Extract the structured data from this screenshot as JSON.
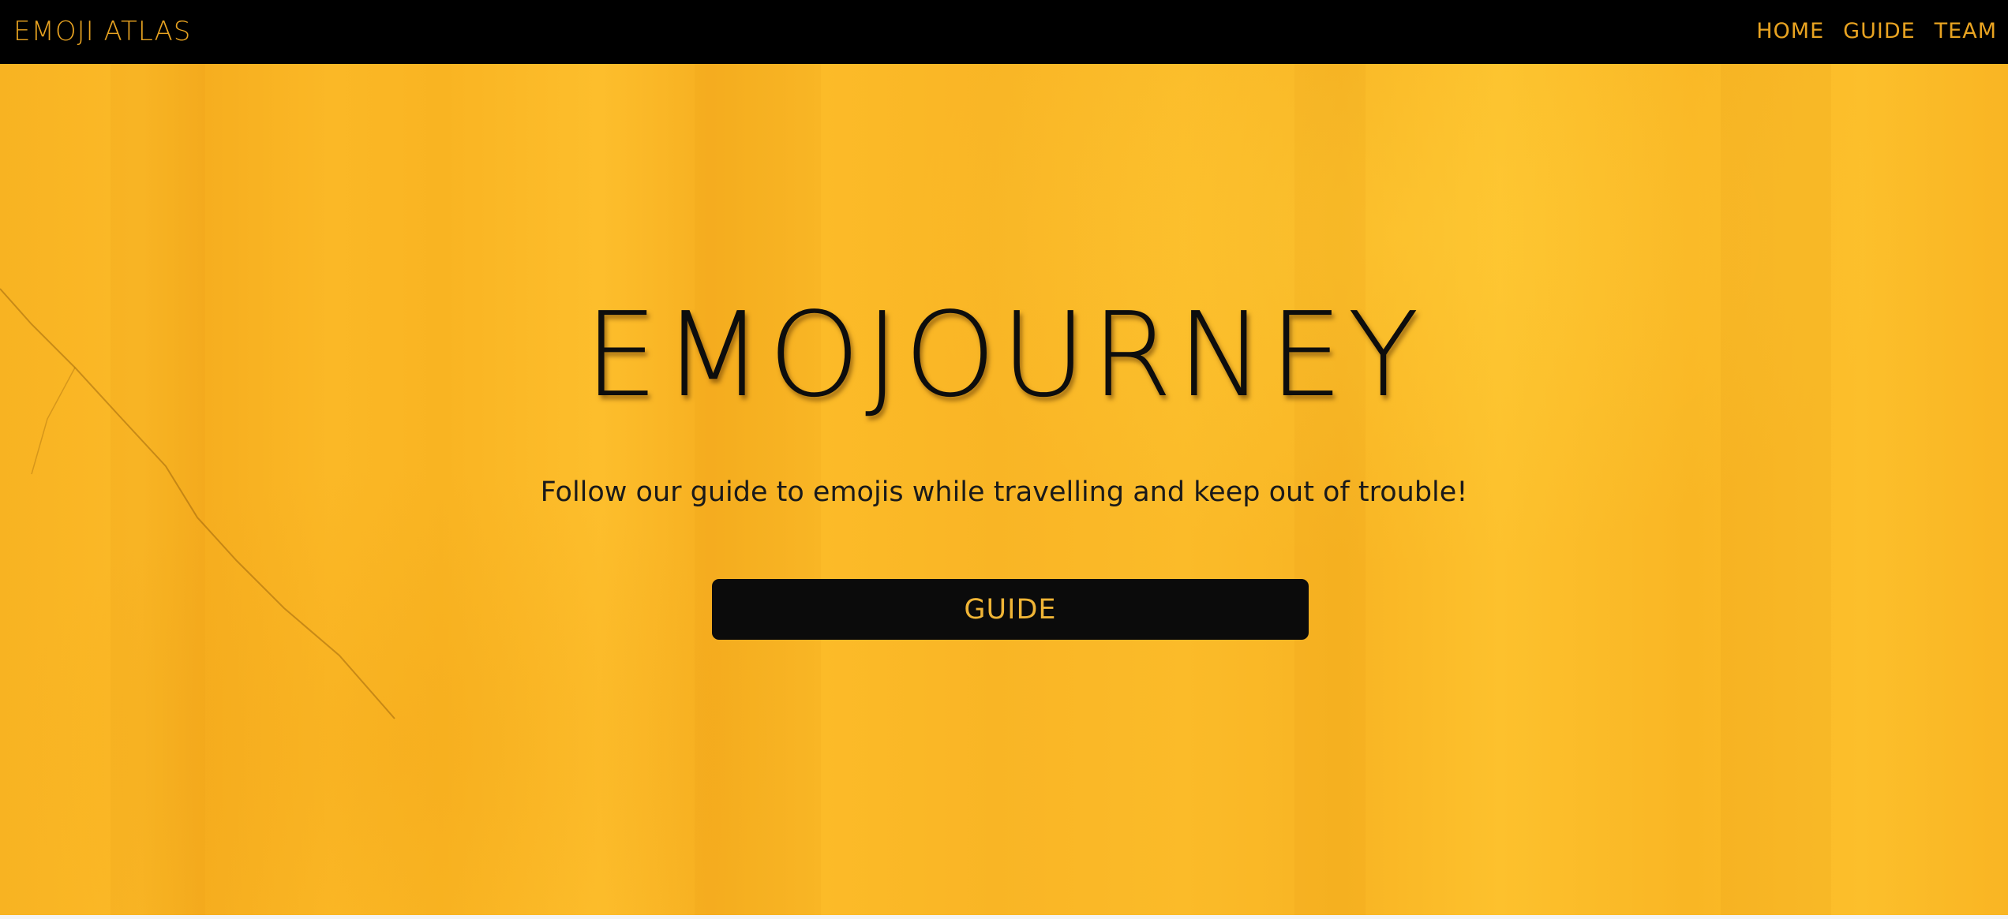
{
  "nav": {
    "brand": "EMOJI ATLAS",
    "links": [
      "HOME",
      "GUIDE",
      "TEAM"
    ]
  },
  "hero": {
    "title": "EMOJOURNEY",
    "subtitle": "Follow our guide to emojis while travelling and keep out of trouble!",
    "button_label": "GUIDE"
  },
  "colors": {
    "navbar_bg": "#000000",
    "nav_text": "#e8a321",
    "hero_bg": "#f9b624",
    "button_bg": "#0b0b0b",
    "button_text": "#f0b536"
  }
}
